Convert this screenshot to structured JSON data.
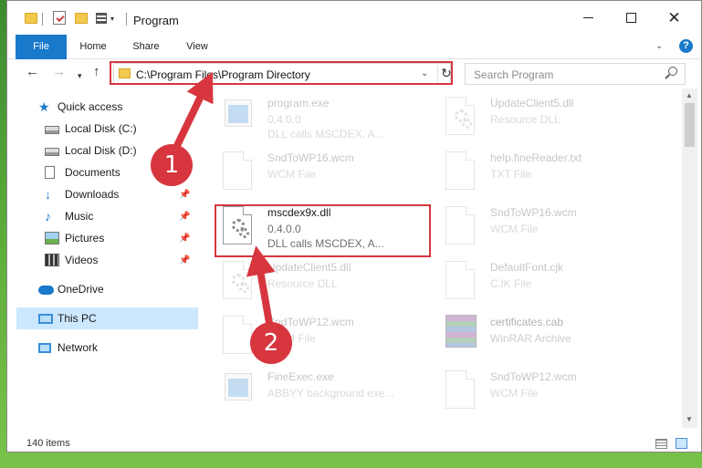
{
  "window": {
    "title": "Program",
    "minimize_symbol": "",
    "close_symbol": "✕"
  },
  "ribbon": {
    "tabs": [
      "File",
      "Home",
      "Share",
      "View"
    ],
    "help_symbol": "?"
  },
  "navigation": {
    "address_path": "C:\\Program Files\\Program Directory",
    "search_placeholder": "Search Program"
  },
  "sidebar": {
    "items": [
      {
        "label": "Quick access",
        "icon": "star-icon"
      },
      {
        "label": "Local Disk (C:)",
        "icon": "drive-icon"
      },
      {
        "label": "Local Disk (D:)",
        "icon": "drive-icon"
      },
      {
        "label": "Documents",
        "icon": "documents-icon"
      },
      {
        "label": "Downloads",
        "icon": "downloads-icon"
      },
      {
        "label": "Music",
        "icon": "music-icon"
      },
      {
        "label": "Pictures",
        "icon": "pictures-icon"
      },
      {
        "label": "Videos",
        "icon": "videos-icon"
      },
      {
        "label": "OneDrive",
        "icon": "onedrive-icon"
      },
      {
        "label": "This PC",
        "icon": "computer-icon",
        "selected": true
      },
      {
        "label": "Network",
        "icon": "network-icon"
      }
    ]
  },
  "files": [
    {
      "name": "program.exe",
      "line2": "0.4.0.0",
      "line3": "DLL calls MSCDEX, A...",
      "icon": "exe-icon"
    },
    {
      "name": "UpdateClient5.dll",
      "line2": "Resource DLL",
      "icon": "dll-icon"
    },
    {
      "name": "SndToWP16.wcm",
      "line2": "WCM File",
      "icon": "file-icon"
    },
    {
      "name": "help.fineReader.txt",
      "line2": "TXT File",
      "icon": "file-icon"
    },
    {
      "name": "mscdex9x.dll",
      "line2": "0.4.0.0",
      "line3": "DLL calls MSCDEX, A...",
      "icon": "dll-icon"
    },
    {
      "name": "SndToWP16.wcm",
      "line2": "WCM File",
      "icon": "file-icon"
    },
    {
      "name": "UpdateClient5.dll",
      "line2": "Resource DLL",
      "icon": "dll-icon"
    },
    {
      "name": "DefaultFont.cjk",
      "line2": "CJK File",
      "icon": "file-icon"
    },
    {
      "name": "SndToWP12.wcm",
      "line2": "WCM File",
      "icon": "file-icon"
    },
    {
      "name": "certificates.cab",
      "line2": "WinRAR Archive",
      "icon": "archive-icon"
    },
    {
      "name": "FineExec.exe",
      "line2": "ABBYY background exe...",
      "icon": "exe-icon"
    },
    {
      "name": "SndToWP12.wcm",
      "line2": "WCM File",
      "icon": "file-icon"
    }
  ],
  "status": {
    "item_count": "140 items"
  },
  "annotations": {
    "step1": "1",
    "step2": "2",
    "highlight_color": "#d7363f"
  },
  "colors": {
    "accent": "#1979ca",
    "selection": "#cce8ff"
  }
}
